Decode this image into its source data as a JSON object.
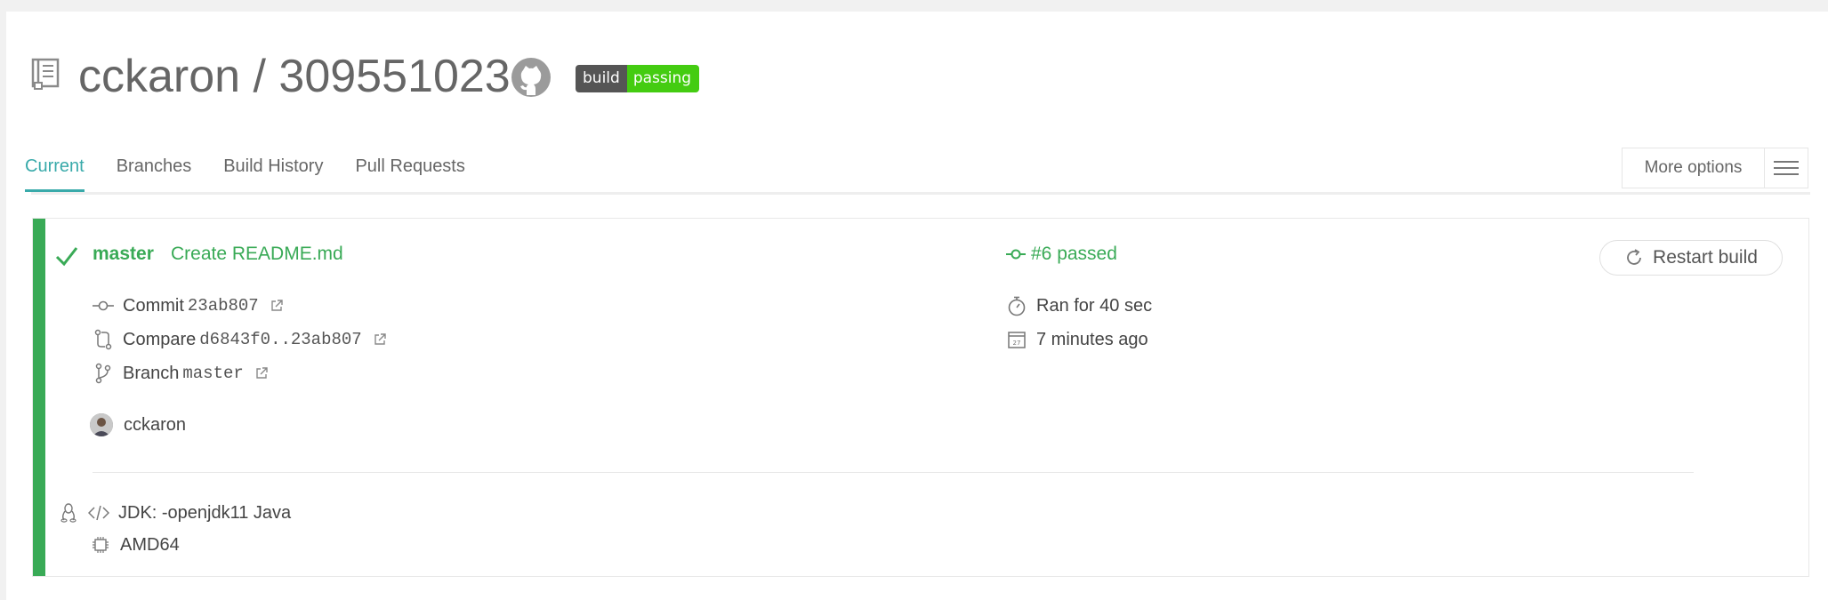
{
  "header": {
    "repo_title": "cckaron / 309551023",
    "badge_left": "build",
    "badge_right": "passing"
  },
  "tabs": [
    {
      "label": "Current",
      "active": true
    },
    {
      "label": "Branches",
      "active": false
    },
    {
      "label": "Build History",
      "active": false
    },
    {
      "label": "Pull Requests",
      "active": false
    }
  ],
  "more_options": {
    "label": "More options"
  },
  "build": {
    "branch": "master",
    "commit_message": "Create README.md",
    "number_status": "#6 passed",
    "restart_label": "Restart build",
    "commit_label": "Commit",
    "commit_hash": "23ab807",
    "compare_label": "Compare",
    "compare_range": "d6843f0..23ab807",
    "branch_label": "Branch",
    "branch_value": "master",
    "duration": "Ran for 40 sec",
    "finished": "7 minutes ago",
    "author": "cckaron",
    "jdk": "JDK: -openjdk11 Java",
    "arch": "AMD64"
  },
  "colors": {
    "passed": "#39aa56",
    "active_tab": "#39aaaa",
    "badge_dark": "#555555",
    "badge_green": "#44cc11"
  },
  "icons": {
    "repo": "repo-icon",
    "github": "github-icon",
    "check": "check-icon",
    "commit": "commit-icon",
    "compare": "compare-icon",
    "branch": "branch-icon",
    "timer": "stopwatch-icon",
    "calendar": "calendar-icon",
    "linux": "linux-icon",
    "code": "code-icon",
    "cpu": "cpu-icon",
    "external": "external-link-icon",
    "restart": "restart-icon",
    "menu": "hamburger-icon"
  }
}
